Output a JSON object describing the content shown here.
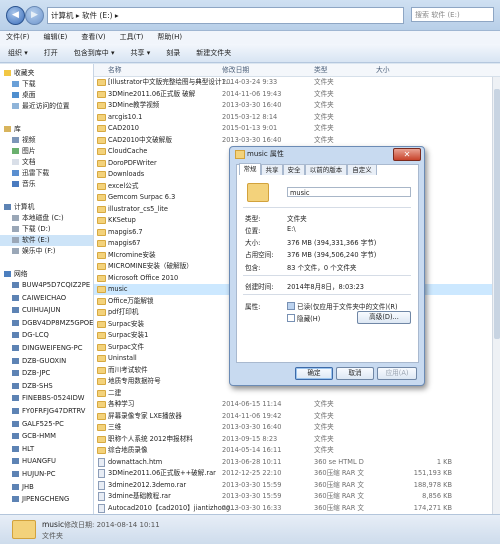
{
  "address": {
    "path": "计算机 ▸ 软件 (E:) ▸",
    "search_placeholder": "搜索 软件 (E:)"
  },
  "menu": [
    "文件(F)",
    "编辑(E)",
    "查看(V)",
    "工具(T)",
    "帮助(H)"
  ],
  "toolbar": [
    "组织 ▾",
    "打开",
    "包含到库中 ▾",
    "共享 ▾",
    "刻录",
    "新建文件夹"
  ],
  "nav": {
    "favorites": "收藏夹",
    "download": "下载",
    "desktop": "桌面",
    "recent": "最近访问的位置",
    "library": "库",
    "video": "视频",
    "pictures": "图片",
    "docs": "文档",
    "thunder": "迅雷下载",
    "music": "音乐",
    "computer": "计算机",
    "drive_c": "本地磁盘 (C:)",
    "drive_d": "下载 (D:)",
    "drive_e": "软件 (E:)",
    "drive_f": "娱乐中 (F:)",
    "network": "网络",
    "hosts": [
      "BUW4P5D7CQIZ2PE",
      "CAIWEICHAO",
      "CUIHUAJUN",
      "DGBV4DP8MZ5GPOE",
      "DG-LCQ",
      "DINGWEIFENG-PC",
      "DZB-GUOXIN",
      "DZB-JPC",
      "DZB-SHS",
      "FINEBBS-0524IDW",
      "FY0FRFJG47DRTRV",
      "GALF525-PC",
      "GCB-HMM",
      "HLT",
      "HUANGFU",
      "HUJUN-PC",
      "JHB",
      "JIPENGCHENG"
    ]
  },
  "columns": {
    "name": "名称",
    "date": "修改日期",
    "type": "类型",
    "size": "大小"
  },
  "files": [
    {
      "name": "[Illustrator中文版完整绘图与典型设计1...",
      "date": "2014-03-24 9:33",
      "type": "文件夹",
      "size": "",
      "kind": "folder"
    },
    {
      "name": "3DMine2011.06正式版 破解",
      "date": "2014-11-06 19:43",
      "type": "文件夹",
      "size": "",
      "kind": "folder"
    },
    {
      "name": "3DMine教学视频",
      "date": "2013-03-30 16:40",
      "type": "文件夹",
      "size": "",
      "kind": "folder"
    },
    {
      "name": "arcgis10.1",
      "date": "2015-03-12 8:14",
      "type": "文件夹",
      "size": "",
      "kind": "folder"
    },
    {
      "name": "CAD2010",
      "date": "2015-01-13 9:01",
      "type": "文件夹",
      "size": "",
      "kind": "folder"
    },
    {
      "name": "CAD2010中文破解版",
      "date": "2013-03-30 16:40",
      "type": "文件夹",
      "size": "",
      "kind": "folder"
    },
    {
      "name": "CloudCache",
      "date": "",
      "type": "",
      "size": "",
      "kind": "folder"
    },
    {
      "name": "DoroPDFWriter",
      "date": "",
      "type": "",
      "size": "",
      "kind": "folder"
    },
    {
      "name": "Downloads",
      "date": "",
      "type": "",
      "size": "",
      "kind": "folder"
    },
    {
      "name": "excel公式",
      "date": "",
      "type": "",
      "size": "",
      "kind": "folder"
    },
    {
      "name": "Gemcom Surpac 6.3",
      "date": "",
      "type": "",
      "size": "",
      "kind": "folder"
    },
    {
      "name": "illustrator_cs5_lite",
      "date": "",
      "type": "",
      "size": "",
      "kind": "folder"
    },
    {
      "name": "KKSetup",
      "date": "",
      "type": "",
      "size": "",
      "kind": "folder"
    },
    {
      "name": "mapgis6.7",
      "date": "",
      "type": "",
      "size": "",
      "kind": "folder"
    },
    {
      "name": "mapgis67",
      "date": "",
      "type": "",
      "size": "",
      "kind": "folder"
    },
    {
      "name": "MIcromine安装",
      "date": "",
      "type": "",
      "size": "",
      "kind": "folder"
    },
    {
      "name": "MICROMINE安装（破解版）",
      "date": "",
      "type": "",
      "size": "",
      "kind": "folder"
    },
    {
      "name": "Microsoft Office 2010",
      "date": "",
      "type": "",
      "size": "",
      "kind": "folder"
    },
    {
      "name": "music",
      "date": "",
      "type": "",
      "size": "",
      "kind": "folder",
      "selected": true
    },
    {
      "name": "Office万能解锁",
      "date": "",
      "type": "",
      "size": "",
      "kind": "folder"
    },
    {
      "name": "pdf打印机",
      "date": "",
      "type": "",
      "size": "",
      "kind": "folder"
    },
    {
      "name": "Surpac安装",
      "date": "",
      "type": "",
      "size": "",
      "kind": "folder"
    },
    {
      "name": "Surpac安装1",
      "date": "",
      "type": "",
      "size": "",
      "kind": "folder"
    },
    {
      "name": "Surpac文件",
      "date": "",
      "type": "",
      "size": "",
      "kind": "folder"
    },
    {
      "name": "Uninstall",
      "date": "",
      "type": "",
      "size": "",
      "kind": "folder"
    },
    {
      "name": "而川考试软件",
      "date": "",
      "type": "",
      "size": "",
      "kind": "folder"
    },
    {
      "name": "地质专用数据符号",
      "date": "",
      "type": "",
      "size": "",
      "kind": "folder"
    },
    {
      "name": "二建",
      "date": "",
      "type": "",
      "size": "",
      "kind": "folder"
    },
    {
      "name": "各种学习",
      "date": "2014-06-15 11:14",
      "type": "文件夹",
      "size": "",
      "kind": "folder"
    },
    {
      "name": "屏幕录像专家 LXE播放器",
      "date": "2014-11-06 19:42",
      "type": "文件夹",
      "size": "",
      "kind": "folder"
    },
    {
      "name": "三维",
      "date": "2013-03-30 16:40",
      "type": "文件夹",
      "size": "",
      "kind": "folder"
    },
    {
      "name": "职称个人系统 2012申报材料",
      "date": "2013-09-15 8:23",
      "type": "文件夹",
      "size": "",
      "kind": "folder"
    },
    {
      "name": "综合地质录像",
      "date": "2014-05-14 16:11",
      "type": "文件夹",
      "size": "",
      "kind": "folder"
    },
    {
      "name": "downattach.htm",
      "date": "2013-06-28 10:11",
      "type": "360 se HTML Do...",
      "size": "1 KB",
      "kind": "file"
    },
    {
      "name": "3DMine2011.06正式版++破解.rar",
      "date": "2012-12-25 22:10",
      "type": "360压缩 RAR 文件",
      "size": "151,193 KB",
      "kind": "file"
    },
    {
      "name": "3dmine2012.3demo.rar",
      "date": "2013-03-30 15:59",
      "type": "360压缩 RAR 文件",
      "size": "188,978 KB",
      "kind": "file"
    },
    {
      "name": "3dmine基础教程.rar",
      "date": "2013-03-30 15:59",
      "type": "360压缩 RAR 文件",
      "size": "8,856 KB",
      "kind": "file"
    },
    {
      "name": "Autocad2010【cad2010】jiantizhong...",
      "date": "2013-03-30 16:33",
      "type": "360压缩 RAR 文件",
      "size": "174,271 KB",
      "kind": "file"
    }
  ],
  "status": {
    "name": "music",
    "meta": "修改日期: 2014-08-14 10:11",
    "type": "文件夹"
  },
  "dialog": {
    "title": "music 属性",
    "close": "✕",
    "tabs": [
      "常规",
      "共享",
      "安全",
      "以前的版本",
      "自定义"
    ],
    "folder_name": "music",
    "rows": [
      {
        "label": "类型:",
        "value": "文件夹"
      },
      {
        "label": "位置:",
        "value": "E:\\"
      },
      {
        "label": "大小:",
        "value": "376 MB (394,331,366 字节)"
      },
      {
        "label": "占用空间:",
        "value": "376 MB (394,506,240 字节)"
      },
      {
        "label": "包含:",
        "value": "83 个文件，0 个文件夹"
      },
      {
        "label": "创建时间:",
        "value": "2014年8月8日，8:03:23"
      }
    ],
    "attr_label": "属性:",
    "readonly": "已读(仅应用于文件夹中的文件)(R)",
    "hidden": "隐藏(H)",
    "advanced": "高级(D)...",
    "ok": "确定",
    "cancel": "取消",
    "apply": "应用(A)"
  }
}
